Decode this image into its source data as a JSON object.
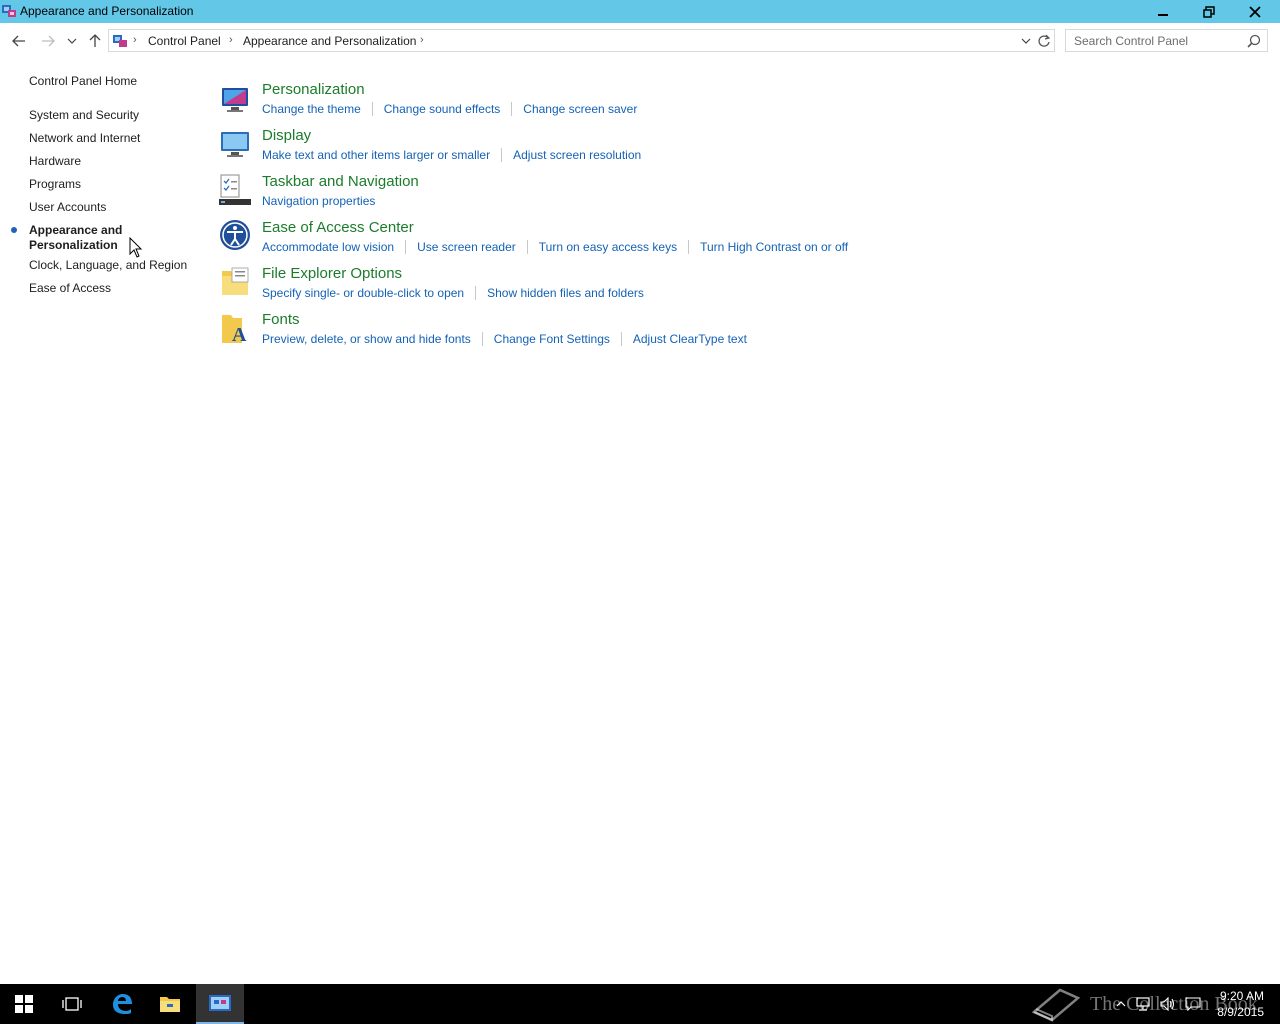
{
  "window": {
    "title": "Appearance and Personalization"
  },
  "address_bar": {
    "crumbs": [
      "Control Panel",
      "Appearance and Personalization"
    ]
  },
  "search": {
    "placeholder": "Search Control Panel"
  },
  "left_nav": {
    "home": "Control Panel Home",
    "items": [
      "System and Security",
      "Network and Internet",
      "Hardware",
      "Programs",
      "User Accounts",
      "Appearance and Personalization",
      "Clock, Language, and Region",
      "Ease of Access"
    ],
    "active_index": 5
  },
  "categories": [
    {
      "icon": "personalization-icon",
      "title": "Personalization",
      "links": [
        "Change the theme",
        "Change sound effects",
        "Change screen saver"
      ]
    },
    {
      "icon": "display-icon",
      "title": "Display",
      "links": [
        "Make text and other items larger or smaller",
        "Adjust screen resolution"
      ]
    },
    {
      "icon": "taskbar-icon",
      "title": "Taskbar and Navigation",
      "links": [
        "Navigation properties"
      ]
    },
    {
      "icon": "ease-of-access-icon",
      "title": "Ease of Access Center",
      "links": [
        "Accommodate low vision",
        "Use screen reader",
        "Turn on easy access keys",
        "Turn High Contrast on or off"
      ]
    },
    {
      "icon": "folder-options-icon",
      "title": "File Explorer Options",
      "links": [
        "Specify single- or double-click to open",
        "Show hidden files and folders"
      ]
    },
    {
      "icon": "fonts-icon",
      "title": "Fonts",
      "links": [
        "Preview, delete, or show and hide fonts",
        "Change Font Settings",
        "Adjust ClearType text"
      ]
    }
  ],
  "taskbar": {
    "watermark": "The Collection Book",
    "time": "9:20 AM",
    "date": "8/9/2015"
  },
  "colors": {
    "titlebar": "#63c7e8",
    "category_title": "#1c7c2c",
    "link": "#1462b6",
    "taskbar": "#000000"
  }
}
